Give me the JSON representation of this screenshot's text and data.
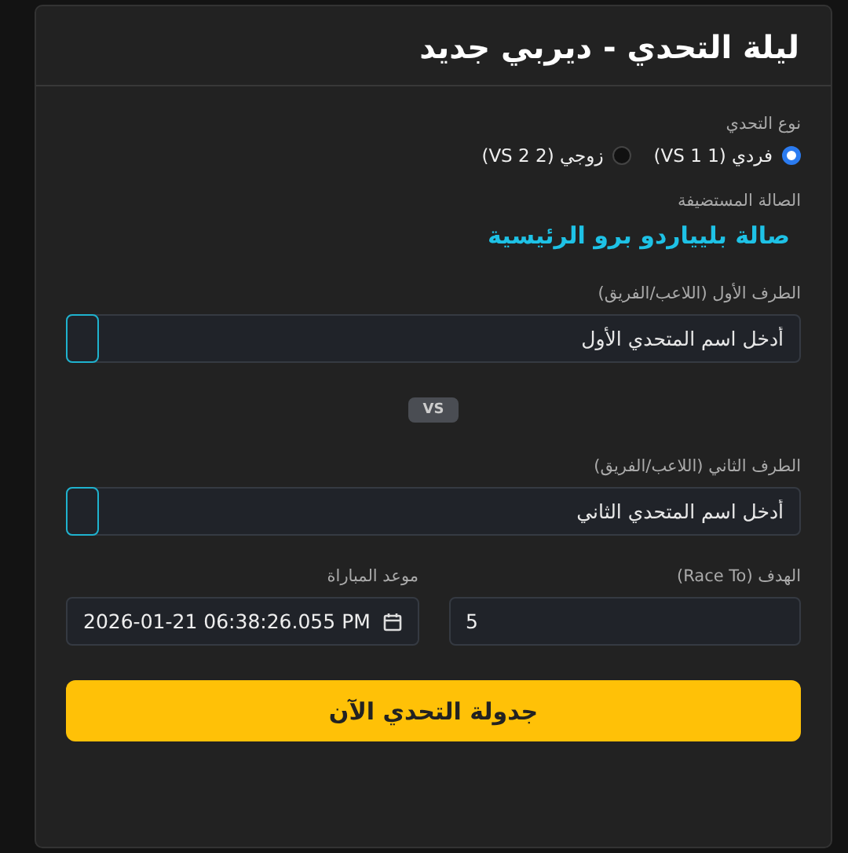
{
  "card": {
    "title": "ليلة التحدي - ديربي جديد"
  },
  "challenge_type": {
    "label": "نوع التحدي",
    "options": [
      {
        "label": "فردي (1 VS 1)",
        "selected": true
      },
      {
        "label": "زوجي (2 VS 2)",
        "selected": false
      }
    ]
  },
  "venue": {
    "label": "الصالة المستضيفة",
    "value": "صالة بليياردو برو الرئيسية"
  },
  "first_side": {
    "label": "الطرف الأول (اللاعب/الفريق)",
    "placeholder": "أدخل اسم المتحدي الأول"
  },
  "versus": "VS",
  "second_side": {
    "label": "الطرف الثاني (اللاعب/الفريق)",
    "placeholder": "أدخل اسم المتحدي الثاني"
  },
  "race_to": {
    "label": "الهدف (Race To)",
    "value": "5"
  },
  "match_time": {
    "label": "موعد المباراة",
    "value": "2026-01-21 06:38:26.055 PM"
  },
  "submit_button": "جدولة التحدي الآن"
}
